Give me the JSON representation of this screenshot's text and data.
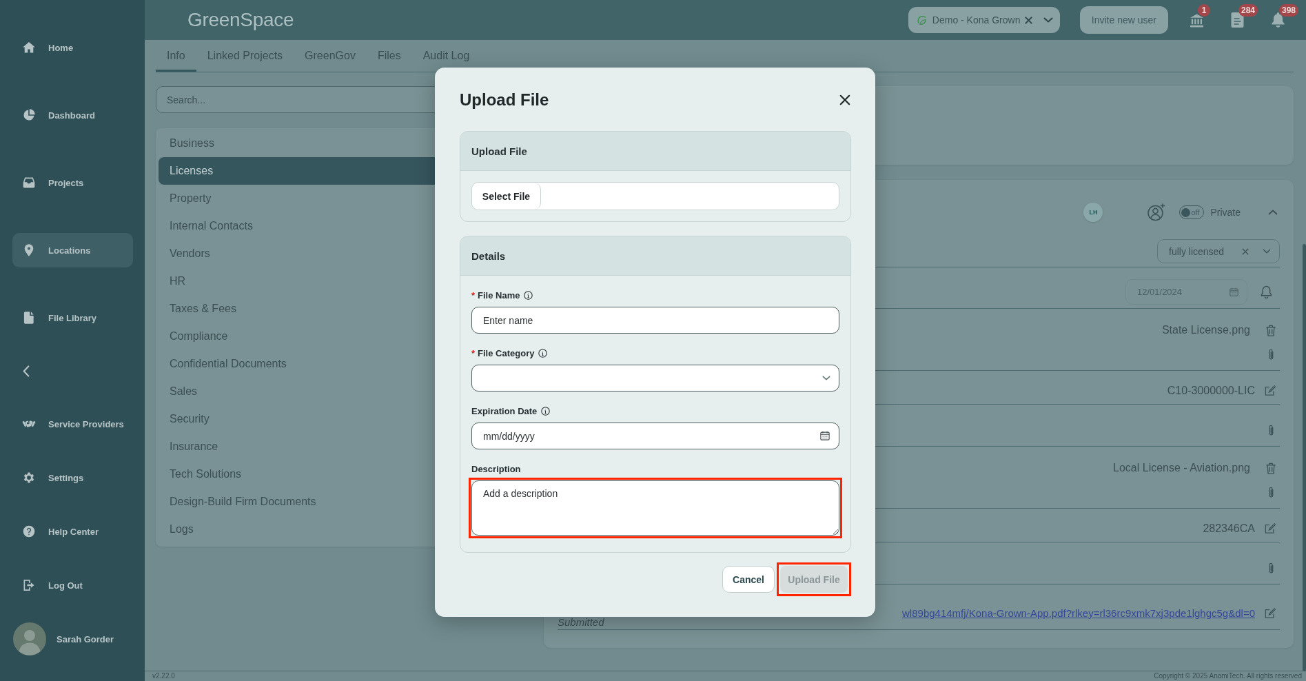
{
  "sidebar": {
    "primary_items": [
      {
        "label": "Home",
        "selected": false
      },
      {
        "label": "Dashboard",
        "selected": false
      },
      {
        "label": "Projects",
        "selected": false
      },
      {
        "label": "Locations",
        "selected": true
      },
      {
        "label": "File Library",
        "selected": false
      }
    ],
    "secondary_items": [
      {
        "label": "Service Providers",
        "selected": false
      },
      {
        "label": "Settings",
        "selected": false
      },
      {
        "label": "Help Center",
        "selected": false
      },
      {
        "label": "Log Out",
        "selected": false
      }
    ],
    "user": {
      "name": "Sarah Gorder"
    }
  },
  "header": {
    "logo": "GreenSpace",
    "organization": {
      "value": "Demo - Kona Grown"
    },
    "invite_button": "Invite new user",
    "notifications": [
      {
        "count": "1"
      },
      {
        "count": "284"
      },
      {
        "count": "398"
      }
    ]
  },
  "tabs": [
    {
      "label": "Info",
      "selected": true
    },
    {
      "label": "Linked Projects",
      "selected": false
    },
    {
      "label": "GreenGov",
      "selected": false
    },
    {
      "label": "Files",
      "selected": false
    },
    {
      "label": "Audit Log",
      "selected": false
    }
  ],
  "search": {
    "placeholder": "Search..."
  },
  "categories": [
    {
      "label": "Business",
      "selected": false
    },
    {
      "label": "Licenses",
      "selected": true
    },
    {
      "label": "Property",
      "selected": false
    },
    {
      "label": "Internal Contacts",
      "selected": false
    },
    {
      "label": "Vendors",
      "selected": false
    },
    {
      "label": "HR",
      "selected": false
    },
    {
      "label": "Taxes & Fees",
      "selected": false
    },
    {
      "label": "Compliance",
      "selected": false
    },
    {
      "label": "Confidential Documents",
      "selected": false
    },
    {
      "label": "Sales",
      "selected": false
    },
    {
      "label": "Security",
      "selected": false
    },
    {
      "label": "Insurance",
      "selected": false
    },
    {
      "label": "Tech Solutions",
      "selected": false
    },
    {
      "label": "Design-Build Firm Documents",
      "selected": false
    },
    {
      "label": "Logs",
      "selected": false
    }
  ],
  "license_card": {
    "assignee_initials": "LH",
    "privacy_toggle": {
      "label": "off",
      "on": false
    },
    "privacy_label": "Private",
    "expanded": true,
    "rows": [
      {
        "kind": "select",
        "value": "fully licensed"
      },
      {
        "kind": "date",
        "value": "12/01/2024"
      },
      {
        "kind": "file",
        "value": "State License.png"
      },
      {
        "kind": "text",
        "value": "C10-3000000-LIC"
      },
      {
        "kind": "attachment"
      },
      {
        "kind": "file",
        "value": "Local License - Aviation.png"
      },
      {
        "kind": "text",
        "value": "282346CA"
      },
      {
        "kind": "attachment"
      },
      {
        "kind": "link",
        "value": "wl89bg414mfj/Kona-Grown-App.pdf?rlkey=rl36rc9xmk7xj3pde1lghgc5g&dl=0",
        "status": "Submitted"
      }
    ]
  },
  "modal": {
    "title": "Upload File",
    "file_section": {
      "title": "Upload File",
      "button": "Select File"
    },
    "details_section": {
      "title": "Details",
      "fields": [
        {
          "kind": "text",
          "marker": "*",
          "label": "File Name",
          "info": true,
          "placeholder": "Enter name",
          "highlighted": false
        },
        {
          "kind": "select",
          "marker": "*",
          "label": "File Category",
          "info": true,
          "highlighted": false
        },
        {
          "kind": "date",
          "label": "Expiration Date",
          "info": true,
          "placeholder": "mm/dd/yyyy",
          "highlighted": false
        },
        {
          "kind": "textarea",
          "label": "Description",
          "info": false,
          "placeholder": "Add a description",
          "highlighted": true
        }
      ]
    },
    "buttons": [
      {
        "kind": "secondary",
        "label": "Cancel",
        "disabled": false,
        "highlighted": false
      },
      {
        "kind": "primary",
        "label": "Upload File",
        "disabled": true,
        "highlighted": true
      }
    ]
  },
  "footer": {
    "version": "v2.22.0",
    "copyright": "Copyright © 2025 AnamiTech. All rights reserved"
  }
}
